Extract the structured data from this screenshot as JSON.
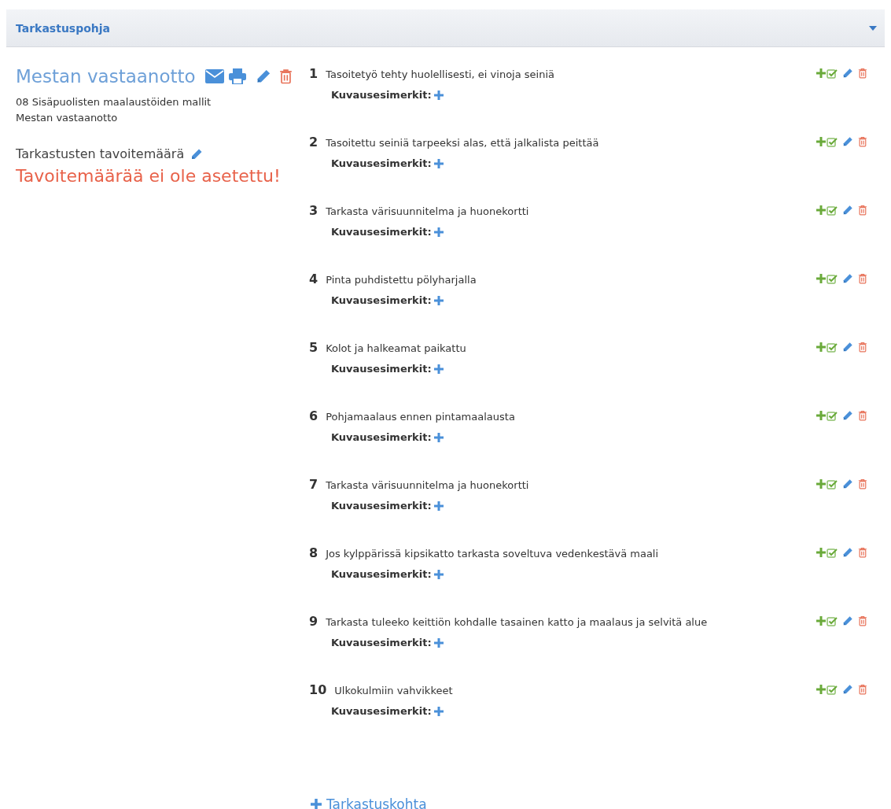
{
  "panel": {
    "title": "Tarkastuspohja",
    "expanded": true
  },
  "template": {
    "name": "Mestan vastaanotto",
    "category": "08 Sisäpuolisten maalaustöiden mallit",
    "subtitle": "Mestan vastaanotto",
    "target_label": "Tarkastusten tavoitemäärä",
    "target_warning": "Tavoitemäärää ei ole asetettu!"
  },
  "items": [
    {
      "number": "1",
      "text": "Tasoitetyö tehty huolellisesti, ei vinoja seiniä",
      "examples_label": "Kuvausesimerkit:"
    },
    {
      "number": "2",
      "text": "Tasoitettu seiniä tarpeeksi alas, että jalkalista peittää",
      "examples_label": "Kuvausesimerkit:"
    },
    {
      "number": "3",
      "text": "Tarkasta värisuunnitelma ja huonekortti",
      "examples_label": "Kuvausesimerkit:"
    },
    {
      "number": "4",
      "text": "Pinta puhdistettu pölyharjalla",
      "examples_label": "Kuvausesimerkit:"
    },
    {
      "number": "5",
      "text": "Kolot ja halkeamat paikattu",
      "examples_label": "Kuvausesimerkit:"
    },
    {
      "number": "6",
      "text": "Pohjamaalaus ennen pintamaalausta",
      "examples_label": "Kuvausesimerkit:"
    },
    {
      "number": "7",
      "text": "Tarkasta värisuunnitelma ja huonekortti",
      "examples_label": "Kuvausesimerkit:"
    },
    {
      "number": "8",
      "text": "Jos kylppärissä kipsikatto tarkasta soveltuva vedenkestävä maali",
      "examples_label": "Kuvausesimerkit:"
    },
    {
      "number": "9",
      "text": "Tarkasta tuleeko keittiön kohdalle tasainen katto ja maalaus ja selvitä alue",
      "examples_label": "Kuvausesimerkit:"
    },
    {
      "number": "10",
      "text": "Ulkokulmiin vahvikkeet",
      "examples_label": "Kuvausesimerkit:"
    }
  ],
  "add_item_label": "Tarkastuskohta"
}
